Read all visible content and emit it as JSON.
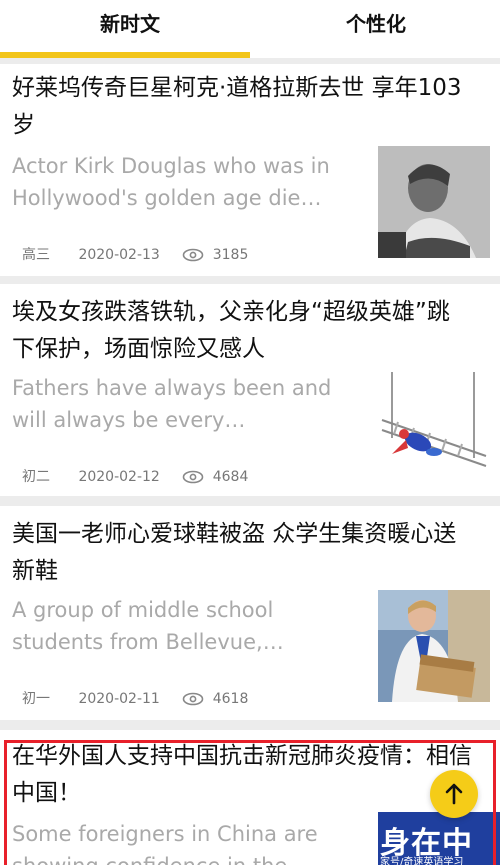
{
  "tabs": [
    {
      "label": "新时文",
      "active": true
    },
    {
      "label": "个性化",
      "active": false
    }
  ],
  "accent_color": "#f2c51a",
  "articles": [
    {
      "headline": "好莱坞传奇巨星柯克·道格拉斯去世 享年103岁",
      "summary": "Actor Kirk Douglas who was in Hollywood's golden age die…",
      "grade": "高三",
      "date": "2020-02-13",
      "views": "3185",
      "thumbnail_icon": "portrait-photo"
    },
    {
      "headline": "埃及女孩跌落铁轨，父亲化身“超级英雄”跳下保护，场面惊险又感人",
      "summary": "Fathers have always been and will always be every…",
      "grade": "初二",
      "date": "2020-02-12",
      "views": "4684",
      "thumbnail_icon": "superhero-railway-illustration"
    },
    {
      "headline": "美国一老师心爱球鞋被盗 众学生集资暖心送新鞋",
      "summary": "A group of middle school students from Bellevue,…",
      "grade": "初一",
      "date": "2020-02-11",
      "views": "4618",
      "thumbnail_icon": "teacher-shoebox-photo"
    },
    {
      "headline": "在华外国人支持中国抗击新冠肺炎疫情：相信中国！",
      "summary": "Some foreigners in China are showing confidence in the…",
      "thumbnail_text": "身在中国",
      "watermark": "家号/奇速英语学习",
      "highlighted": true,
      "highlight_color": "#e8202a"
    }
  ],
  "scroll_top_icon": "arrow-up-icon"
}
